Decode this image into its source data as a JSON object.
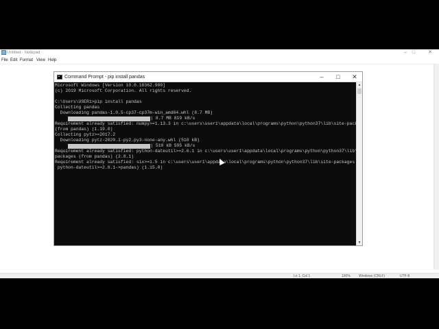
{
  "notepad": {
    "title": "Untitled - Notepad",
    "menu": [
      "File",
      "Edit",
      "Format",
      "View",
      "Help"
    ],
    "status": {
      "position": "Ln 1, Col 1",
      "zoom": "100%",
      "line_ending": "Windows (CRLF)",
      "encoding": "UTF-8"
    },
    "controls": {
      "minimize": "–",
      "maximize": "□",
      "close": "✕"
    }
  },
  "cmd": {
    "title": "Command Prompt - pip  install pandas",
    "controls": {
      "minimize": "–",
      "maximize": "□",
      "close": "✕"
    },
    "lines": [
      "Microsoft Windows [Version 10.0.18362.900]",
      "(c) 2019 Microsoft Corporation. All rights reserved.",
      "",
      "C:\\Users\\USER1>pip install pandas",
      "Collecting pandas",
      "  Downloading pandas-1.0.5-cp37-cp37m-win_amd64.whl (8.7 MB)",
      "PROGRESS1",
      "Requirement already satisfied: numpy>=1.13.3 in c:\\users\\user1\\appdata\\local\\programs\\python\\python37\\lib\\site-packages",
      "(from pandas) (1.19.0)",
      "Collecting pytz>=2017.2",
      "  Downloading pytz-2020.1-py2.py3-none-any.whl (510 kB)",
      "PROGRESS2",
      "Requirement already satisfied: python-dateutil>=2.6.1 in c:\\users\\user1\\appdata\\local\\programs\\python\\python37\\lib\\site-",
      "packages (from pandas) (2.8.1)",
      "Requirement already satisfied: six>=1.5 in c:\\users\\user1\\appdata\\local\\programs\\python\\python37\\lib\\site-packages (from",
      " python-dateutil>=2.6.1->pandas) (1.15.0)"
    ],
    "progress": [
      {
        "label": "| 8.7 MB 819 kB/s"
      },
      {
        "label": "| 510 kB 595 kB/s"
      }
    ]
  }
}
